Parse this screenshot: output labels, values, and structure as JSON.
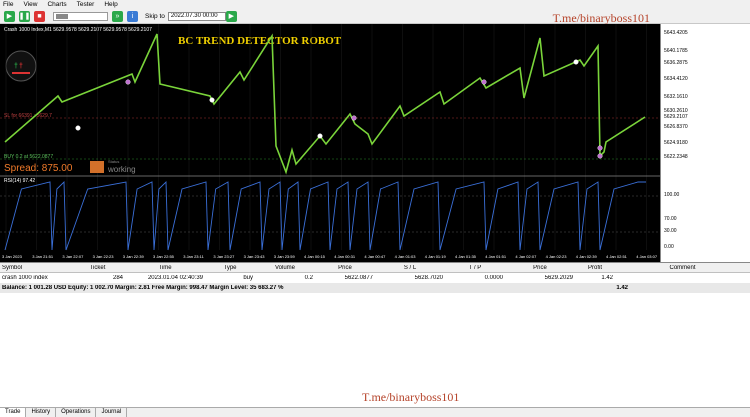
{
  "menu": [
    "File",
    "View",
    "Charts",
    "Tester",
    "Help"
  ],
  "toolbar": {
    "skip_label": "Skip to",
    "skip_value": "2022.07.30 00:00"
  },
  "brand_top": "T.me/binaryboss101",
  "brand_bottom": "T.me/binaryboss101",
  "chart": {
    "info": "Crash 1000 Index,M1  5629.9578 5629.2107 5629.9578 5629.2107",
    "robot_title": "BC TREND DETECTOR ROBOT",
    "sl_label": "SL for 66391 : 5629.7",
    "buy_label": "BUY 0.2 at 5622.0877",
    "spread_label": "Spread: 875.00",
    "status_small": "Status",
    "status_text": "working",
    "indicator_label": "RSI(14) 97.42",
    "price_ticks": [
      "5643.4205",
      "5640.1785",
      "5636.2875",
      "5634.4120",
      "5632.1610",
      "5630.2610",
      "5629.2107",
      "5626.8370",
      "5624.9180",
      "5622.2348"
    ],
    "rsi_ticks": [
      "100.00",
      "70.00",
      "30.00",
      "0.00"
    ],
    "time_ticks": [
      "3 Jan 2023",
      "3 Jan 21:51",
      "3 Jan 22:07",
      "3 Jan 22:23",
      "3 Jan 22:39",
      "3 Jan 22:55",
      "3 Jan 23:11",
      "3 Jan 23:27",
      "3 Jan 23:43",
      "3 Jan 23:59",
      "4 Jan 00:15",
      "4 Jan 00:31",
      "4 Jan 00:47",
      "4 Jan 01:03",
      "4 Jan 01:19",
      "4 Jan 01:35",
      "4 Jan 01:51",
      "4 Jan 02:07",
      "4 Jan 02:23",
      "4 Jan 02:39",
      "4 Jan 02:51",
      "4 Jan 03:07"
    ],
    "colors": {
      "price_line": "#7ad43a",
      "rsi_line": "#3a6fd8",
      "background": "#000000",
      "spread": "#f07a2a"
    }
  },
  "terminal": {
    "headers": [
      "Symbol",
      "Ticket",
      "Time",
      "Type",
      "Volume",
      "Price",
      "S / L",
      "T / P",
      "Price",
      "Profit",
      "Comment"
    ],
    "rows": [
      [
        "crash 1000 index",
        "284",
        "2023.01.04 02:40:39",
        "buy",
        "0.2",
        "5622.0877",
        "5628.7020",
        "0.0000",
        "5629.2029",
        "1.42",
        ""
      ]
    ],
    "balance": "Balance: 1 001.28 USD  Equity: 1 002.70  Margin: 2.81  Free Margin: 998.47  Margin Level: 35 683.27 %",
    "balance_profit": "1.42",
    "tabs": [
      "Trade",
      "History",
      "Operations",
      "Journal"
    ]
  }
}
